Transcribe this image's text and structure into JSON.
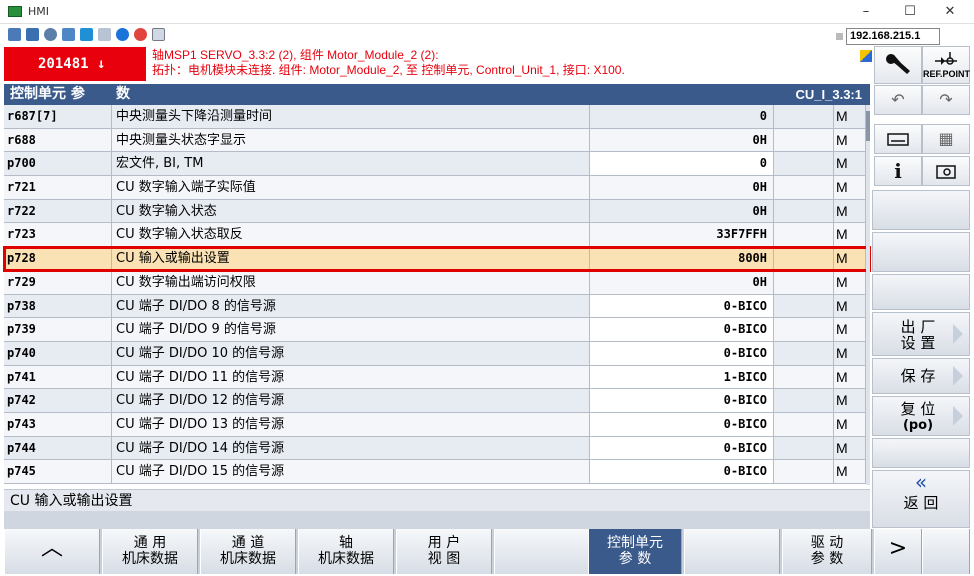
{
  "window": {
    "title": "HMI",
    "minimize": "–",
    "maximize": "☐",
    "close": "✕"
  },
  "connection": {
    "ip": "192.168.215.1"
  },
  "alarm": {
    "number": "201481 ↓",
    "line1": "轴MSP1 SERVO_3.3:2 (2), 组件 Motor_Module_2 (2):",
    "line2": "拓扑：电机模块未连接. 组件: Motor_Module_2, 至 控制单元, Control_Unit_1, 接口: X100."
  },
  "header_buttons": {
    "ref_point": "REF.POINT"
  },
  "table": {
    "col_param": "控制单元 参",
    "col_desc": "数",
    "axis": "CU_I_3.3:1",
    "rows": [
      {
        "id": "r687[7]",
        "desc": "中央测量头下降沿测量时间",
        "value": "0",
        "unit": "",
        "access": "M",
        "editable": false
      },
      {
        "id": "r688",
        "desc": "中央测量头状态字显示",
        "value": "0H",
        "unit": "",
        "access": "M",
        "editable": false
      },
      {
        "id": "p700",
        "desc": "宏文件, BI, TM",
        "value": "0",
        "unit": "",
        "access": "M",
        "editable": true
      },
      {
        "id": "r721",
        "desc": "CU 数字输入端子实际值",
        "value": "0H",
        "unit": "",
        "access": "M",
        "editable": false
      },
      {
        "id": "r722",
        "desc": "CU 数字输入状态",
        "value": "0H",
        "unit": "",
        "access": "M",
        "editable": false
      },
      {
        "id": "r723",
        "desc": "CU 数字输入状态取反",
        "value": "33F7FFH",
        "unit": "",
        "access": "M",
        "editable": false
      },
      {
        "id": "p728",
        "desc": "CU 输入或输出设置",
        "value": "800H",
        "unit": "",
        "access": "M",
        "editable": true,
        "selected": true
      },
      {
        "id": "r729",
        "desc": "CU 数字输出端访问权限",
        "value": "0H",
        "unit": "",
        "access": "M",
        "editable": false
      },
      {
        "id": "p738",
        "desc": "CU 端子 DI/DO 8 的信号源",
        "value": "0-BICO",
        "unit": "",
        "access": "M",
        "editable": true
      },
      {
        "id": "p739",
        "desc": "CU 端子 DI/DO 9 的信号源",
        "value": "0-BICO",
        "unit": "",
        "access": "M",
        "editable": true
      },
      {
        "id": "p740",
        "desc": "CU 端子 DI/DO 10 的信号源",
        "value": "0-BICO",
        "unit": "",
        "access": "M",
        "editable": true
      },
      {
        "id": "p741",
        "desc": "CU 端子 DI/DO 11 的信号源",
        "value": "1-BICO",
        "unit": "",
        "access": "M",
        "editable": true
      },
      {
        "id": "p742",
        "desc": "CU 端子 DI/DO 12 的信号源",
        "value": "0-BICO",
        "unit": "",
        "access": "M",
        "editable": true
      },
      {
        "id": "p743",
        "desc": "CU 端子 DI/DO 13 的信号源",
        "value": "0-BICO",
        "unit": "",
        "access": "M",
        "editable": true
      },
      {
        "id": "p744",
        "desc": "CU 端子 DI/DO 14 的信号源",
        "value": "0-BICO",
        "unit": "",
        "access": "M",
        "editable": true
      },
      {
        "id": "p745",
        "desc": "CU 端子 DI/DO 15 的信号源",
        "value": "0-BICO",
        "unit": "",
        "access": "M",
        "editable": true
      }
    ]
  },
  "status_text": "CU 输入或输出设置",
  "right_panel": {
    "undo": "↶",
    "redo": "↷",
    "calculator": "▦",
    "info": "i",
    "factory_line1": "出 厂",
    "factory_line2": "设 置",
    "save": "保 存",
    "reset_line1": "复 位",
    "reset_line2": "(po)",
    "back_chevron": "«",
    "back": "返 回"
  },
  "bottom_bar": {
    "up": "︿",
    "general_1": "通 用",
    "general_2": "机床数据",
    "channel_1": "通 道",
    "channel_2": "机床数据",
    "axis_1": "轴",
    "axis_2": "机床数据",
    "user_1": "用 户",
    "user_2": "视 图",
    "cu_1": "控制单元",
    "cu_2": "参 数",
    "drive_1": "驱 动",
    "drive_2": "参 数",
    "next": ">"
  },
  "colors": {
    "header": "#3a5a8c",
    "alarm": "#e8000d",
    "selected_row": "#fbe2b4",
    "highlight_frame": "#e00000"
  }
}
